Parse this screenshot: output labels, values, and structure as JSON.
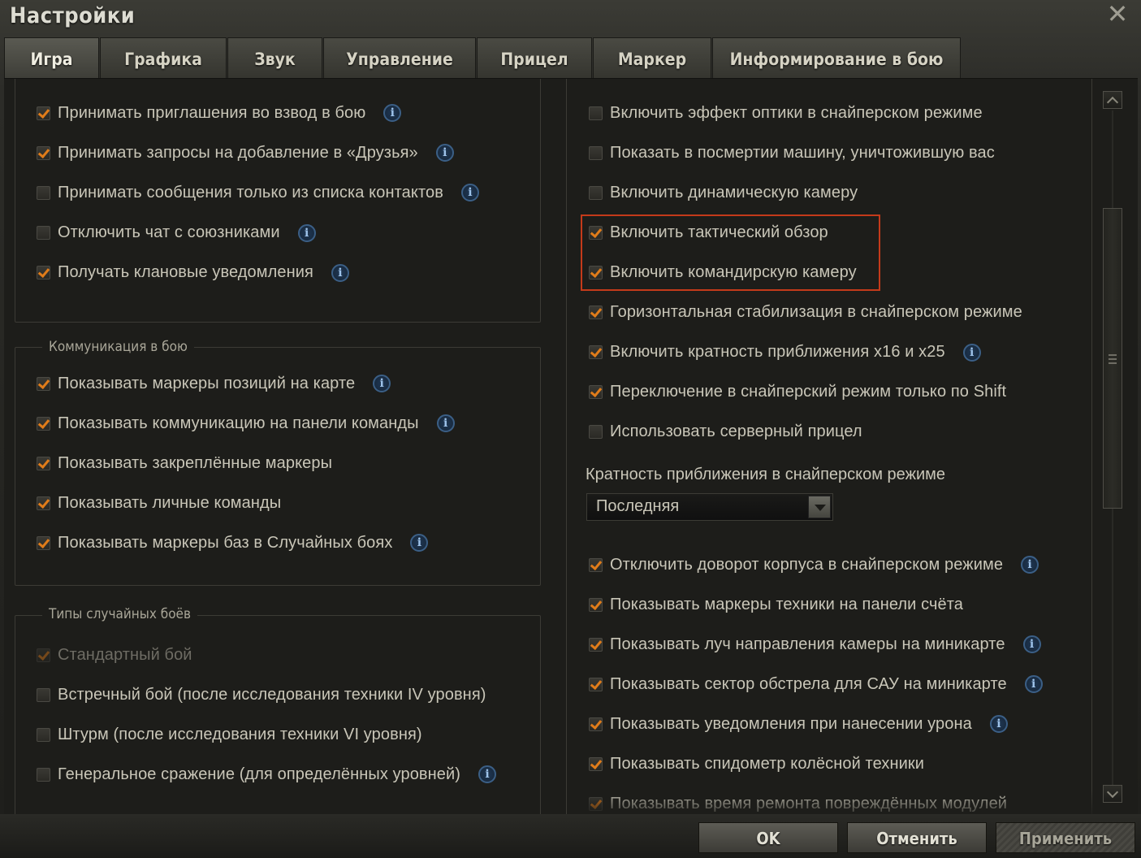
{
  "window": {
    "title": "Настройки",
    "close_label": "✕"
  },
  "tabs": [
    {
      "label": "Игра",
      "active": true
    },
    {
      "label": "Графика",
      "active": false
    },
    {
      "label": "Звук",
      "active": false
    },
    {
      "label": "Управление",
      "active": false
    },
    {
      "label": "Прицел",
      "active": false
    },
    {
      "label": "Маркер",
      "active": false
    },
    {
      "label": "Информирование в бою",
      "active": false
    }
  ],
  "left": {
    "general_options": [
      {
        "label": "Принимать приглашения во взвод в бою",
        "checked": true,
        "info": true
      },
      {
        "label": "Принимать запросы на добавление в «Друзья»",
        "checked": true,
        "info": true
      },
      {
        "label": "Принимать сообщения только из списка контактов",
        "checked": false,
        "info": true
      },
      {
        "label": "Отключить чат с союзниками",
        "checked": false,
        "info": true
      },
      {
        "label": "Получать клановые уведомления",
        "checked": true,
        "info": true
      }
    ],
    "communication": {
      "title": "Коммуникация в бою",
      "options": [
        {
          "label": "Показывать маркеры позиций на карте",
          "checked": true,
          "info": true
        },
        {
          "label": "Показывать коммуникацию на панели команды",
          "checked": true,
          "info": true
        },
        {
          "label": "Показывать закреплённые маркеры",
          "checked": true,
          "info": false
        },
        {
          "label": "Показывать личные команды",
          "checked": true,
          "info": false
        },
        {
          "label": "Показывать маркеры баз в Случайных боях",
          "checked": true,
          "info": true
        }
      ]
    },
    "battle_types": {
      "title": "Типы случайных боёв",
      "options": [
        {
          "label": "Стандартный бой",
          "checked": true,
          "info": false,
          "disabled": true
        },
        {
          "label": "Встречный бой (после исследования техники IV уровня)",
          "checked": false,
          "info": false
        },
        {
          "label": "Штурм (после исследования техники VI уровня)",
          "checked": false,
          "info": false
        },
        {
          "label": "Генеральное сражение (для определённых уровней)",
          "checked": false,
          "info": true
        }
      ]
    }
  },
  "right": {
    "options_top": [
      {
        "label": "Включить эффект оптики в снайперском режиме",
        "checked": false,
        "info": false
      },
      {
        "label": "Показать в посмертии машину, уничтожившую вас",
        "checked": false,
        "info": false
      },
      {
        "label": "Включить динамическую камеру",
        "checked": false,
        "info": false
      },
      {
        "label": "Включить тактический обзор",
        "checked": true,
        "info": false
      },
      {
        "label": "Включить командирскую камеру",
        "checked": true,
        "info": false
      },
      {
        "label": "Горизонтальная стабилизация в снайперском режиме",
        "checked": true,
        "info": false
      },
      {
        "label": "Включить кратность приближения x16 и x25",
        "checked": true,
        "info": true
      },
      {
        "label": "Переключение в снайперский режим только по Shift",
        "checked": true,
        "info": false
      },
      {
        "label": "Использовать серверный прицел",
        "checked": false,
        "info": false
      }
    ],
    "zoom": {
      "label": "Кратность приближения в снайперском режиме",
      "selected": "Последняя"
    },
    "options_bottom": [
      {
        "label": "Отключить доворот корпуса в снайперском режиме",
        "checked": true,
        "info": true
      },
      {
        "label": "Показывать маркеры техники на панели счёта",
        "checked": true,
        "info": false
      },
      {
        "label": "Показывать луч направления камеры на миникарте",
        "checked": true,
        "info": true
      },
      {
        "label": "Показывать сектор обстрела для САУ на миникарте",
        "checked": true,
        "info": true
      },
      {
        "label": "Показывать уведомления при нанесении урона",
        "checked": true,
        "info": true
      },
      {
        "label": "Показывать спидометр колёсной техники",
        "checked": true,
        "info": false
      },
      {
        "label": "Показывать время ремонта повреждённых модулей",
        "checked": true,
        "info": false
      }
    ]
  },
  "footer": {
    "ok_label": "OK",
    "cancel_label": "Отменить",
    "apply_label": "Применить"
  },
  "colors": {
    "check_accent": "#e07c1a",
    "highlight": "#c43a1a",
    "info_blue": "#3b5f86"
  }
}
